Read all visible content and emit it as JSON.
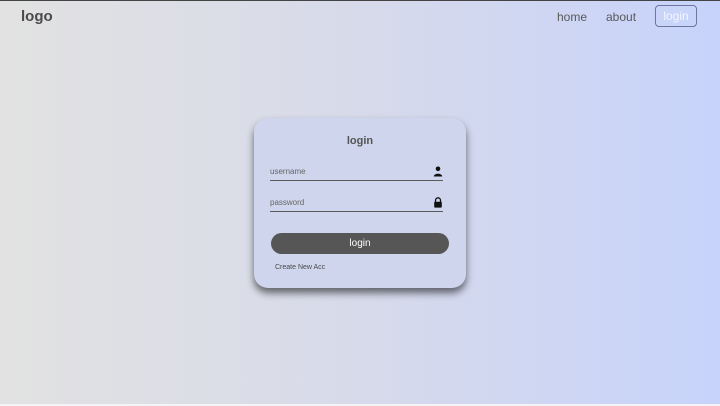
{
  "navbar": {
    "logo": "logo",
    "links": [
      {
        "label": "home"
      },
      {
        "label": "about"
      }
    ],
    "login_button": "login"
  },
  "login_card": {
    "title": "login",
    "username": {
      "placeholder": "username",
      "icon": "user-icon"
    },
    "password": {
      "placeholder": "password",
      "icon": "lock-icon"
    },
    "submit_label": "login",
    "create_account_link": "Create New Acc"
  },
  "colors": {
    "background_start": "#e2e2e2",
    "background_end": "#c7d3fb",
    "card": "#cfd5ec",
    "button": "#565656",
    "text": "#4a4a4a"
  }
}
